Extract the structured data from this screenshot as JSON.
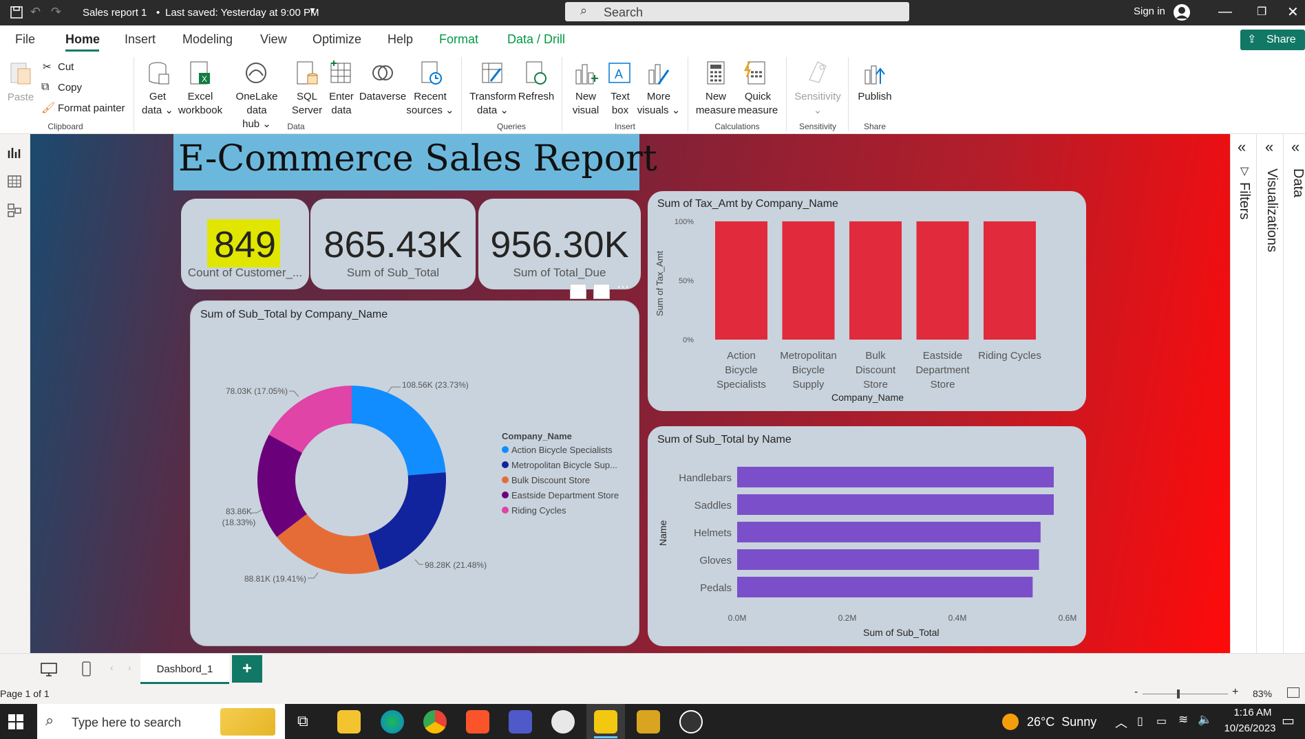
{
  "titlebar": {
    "doc_title": "Sales report 1",
    "save_state": "Last saved: Yesterday at 9:00 PM",
    "search_placeholder": "Search",
    "sign_in": "Sign in"
  },
  "menu": {
    "file": "File",
    "home": "Home",
    "insert": "Insert",
    "modeling": "Modeling",
    "view": "View",
    "optimize": "Optimize",
    "help": "Help",
    "format": "Format",
    "data_drill": "Data / Drill",
    "share": "Share"
  },
  "ribbon": {
    "paste": "Paste",
    "cut": "Cut",
    "copy": "Copy",
    "format_painter": "Format painter",
    "clipboard": "Clipboard",
    "get_data": "Get\ndata ⌄",
    "excel": "Excel\nworkbook",
    "onelake": "OneLake data\nhub ⌄",
    "sql": "SQL\nServer",
    "enter_data": "Enter\ndata",
    "dataverse": "Dataverse",
    "recent": "Recent\nsources ⌄",
    "data_group": "Data",
    "transform": "Transform\ndata ⌄",
    "refresh": "Refresh",
    "queries": "Queries",
    "new_visual": "New\nvisual",
    "text_box": "Text\nbox",
    "more_visuals": "More\nvisuals ⌄",
    "insert_group": "Insert",
    "new_measure": "New\nmeasure",
    "quick_measure": "Quick\nmeasure",
    "calculations": "Calculations",
    "sensitivity_btn": "Sensitivity\n⌄",
    "sensitivity": "Sensitivity",
    "publish": "Publish",
    "share_group": "Share"
  },
  "report": {
    "title": "E-Commerce Sales Report",
    "kpi1": {
      "value": "849",
      "label": "Count of Customer_..."
    },
    "kpi2": {
      "value": "865.43K",
      "label": "Sum of Sub_Total"
    },
    "kpi3": {
      "value": "956.30K",
      "label": "Sum of Total_Due"
    }
  },
  "donut": {
    "title": "Sum of Sub_Total by Company_Name",
    "legend_title": "Company_Name",
    "labels": [
      "108.56K (23.73%)",
      "98.28K (21.48%)",
      "88.81K (19.41%)",
      "83.86K",
      "(18.33%)",
      "78.03K (17.05%)"
    ]
  },
  "tax_chart": {
    "title": "Sum of Tax_Amt by Company_Name",
    "ylabel": "Sum of Tax_Amt",
    "xlabel": "Company_Name",
    "ticks": [
      "100%",
      "50%",
      "0%"
    ]
  },
  "sub_chart": {
    "title": "Sum of Sub_Total by Name",
    "ylabel": "Name",
    "xlabel": "Sum of Sub_Total",
    "ticks": [
      "0.0M",
      "0.2M",
      "0.4M",
      "0.6M"
    ]
  },
  "panes": {
    "filters": "Filters",
    "visualizations": "Visualizations",
    "data": "Data"
  },
  "tabs": {
    "page1": "Dashbord_1",
    "add": "+"
  },
  "status": {
    "page": "Page 1 of 1",
    "zoom": "83%"
  },
  "taskbar": {
    "search": "Type here to search",
    "weather": "26°C  Sunny",
    "time": "1:16 AM",
    "date": "10/26/2023"
  },
  "colors": {
    "accent": "#117865",
    "bar_red": "#e12a3b",
    "bar_purple": "#7b4fc9",
    "title_bg": "#6cb8dc",
    "kpi_highlight": "#e1e600"
  },
  "chart_data": [
    {
      "type": "pie",
      "title": "Sum of Sub_Total by Company_Name",
      "categories": [
        "Action Bicycle Specialists",
        "Metropolitan Bicycle Sup...",
        "Bulk Discount Store",
        "Eastside Department Store",
        "Riding Cycles"
      ],
      "values": [
        108.56,
        98.28,
        88.81,
        83.86,
        78.03
      ],
      "percent": [
        23.73,
        21.48,
        19.41,
        18.33,
        17.05
      ],
      "colors": [
        "#118dff",
        "#12239e",
        "#e66c37",
        "#6b007b",
        "#e044a7"
      ],
      "legend": "right"
    },
    {
      "type": "bar",
      "title": "Sum of Tax_Amt by Company_Name",
      "categories": [
        "Action Bicycle Specialists",
        "Metropolitan Bicycle Supply",
        "Bulk Discount Store",
        "Eastside Department Store",
        "Riding Cycles"
      ],
      "values": [
        100,
        100,
        100,
        100,
        100
      ],
      "ylim": [
        0,
        100
      ],
      "ylabel": "Sum of Tax_Amt",
      "xlabel": "Company_Name"
    },
    {
      "type": "bar",
      "orientation": "horizontal",
      "title": "Sum of Sub_Total by Name",
      "categories": [
        "Handlebars",
        "Saddles",
        "Helmets",
        "Gloves",
        "Pedals"
      ],
      "values": [
        0.6,
        0.6,
        0.575,
        0.572,
        0.56
      ],
      "xlim": [
        0,
        0.6
      ],
      "xlabel": "Sum of Sub_Total",
      "ylabel": "Name"
    }
  ]
}
